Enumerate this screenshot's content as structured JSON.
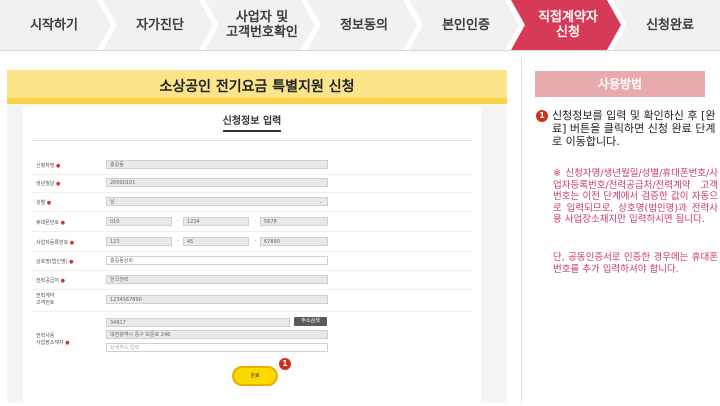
{
  "steps": [
    {
      "label": "시작하기",
      "active": false
    },
    {
      "label": "자가진단",
      "active": false
    },
    {
      "label": "사업자 및\n고객번호확인",
      "active": false
    },
    {
      "label": "정보동의",
      "active": false
    },
    {
      "label": "본인인증",
      "active": false
    },
    {
      "label": "직접계약자\n신청",
      "active": true
    },
    {
      "label": "신청완료",
      "active": false
    }
  ],
  "colors": {
    "active_step": "#d73a57",
    "panel_title_bg": "#fbe48a",
    "usage_head_bg": "#e9aaad",
    "note_text": "#c9386e",
    "badge": "#d0301a",
    "done_button": "#fcd900"
  },
  "panel": {
    "title": "소상공인 전기요금 특별지원 신청",
    "card_title": "신청정보 입력"
  },
  "form": {
    "rows": [
      {
        "label": "신청자명",
        "value": "홍길동"
      },
      {
        "label": "생년월일",
        "value": "20000101"
      },
      {
        "label": "성별",
        "value": "남"
      },
      {
        "label": "휴대폰번호",
        "parts": [
          "010",
          "1234",
          "5678"
        ]
      },
      {
        "label": "사업자등록번호",
        "parts": [
          "123",
          "45",
          "67890"
        ]
      },
      {
        "label": "상호명(법인명)",
        "value": "홍길동상회"
      },
      {
        "label": "전력공급처",
        "value": "한국전력"
      },
      {
        "label": "전력계약\n고객번호",
        "value": "1234567890"
      },
      {
        "label": "전력사용\n사업장소재지",
        "zip": "34917",
        "addr": "대전광역시 중구 보문로 246",
        "detail_placeholder": "상세주소 입력"
      }
    ],
    "address_button": "주소검색",
    "done_button": "완료"
  },
  "badge_number": "1",
  "usage": {
    "title": "사용방법",
    "step_text": "신청정보를 입력 및 확인하신 후 [완료] 버튼을 클릭하면 신청 완료 단계로 이동합니다.",
    "note1": "※ 신청자명/생년월일/성별/휴대폰번호/사업자등록번호/전력공급처/전력계약 고객번호는 이전 단계에서 검증한 값이 자동으로 입력되므로, 상호명(법인명)과 전력사용 사업장소재지만 입력하시면 됩니다.",
    "note2": "단, 공동인증서로 인증한 경우에는 휴대폰번호를 추가 입력하셔야 합니다."
  }
}
